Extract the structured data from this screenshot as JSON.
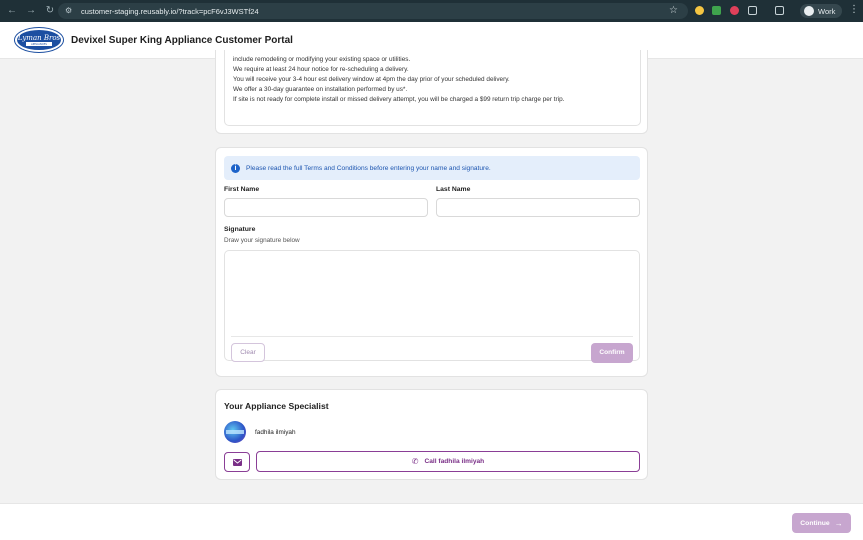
{
  "browser": {
    "url": "customer-staging.reusably.io/?track=pcF6vJ3WSTf24",
    "profile_label": "Work"
  },
  "header": {
    "logo_text": "Lyman Bros",
    "logo_subtext": "APPLIANCES",
    "title": "Devixel Super King Appliance Customer Portal"
  },
  "terms": {
    "lines": [
      "include remodeling or modifying your existing space or utilities.",
      "We require at least 24 hour notice for re-scheduling a delivery.",
      "You will receive your 3-4 hour est delivery window at 4pm the day prior of your scheduled delivery.",
      "We offer a 30-day guarantee on installation performed by us*.",
      "If site is not ready for complete install or missed delivery attempt, you will be charged a $99 return trip charge per trip."
    ]
  },
  "signature_form": {
    "banner_text": "Please read the full Terms and Conditions before entering your name and signature.",
    "first_name_label": "First Name",
    "first_name_value": "",
    "last_name_label": "Last Name",
    "last_name_value": "",
    "signature_label": "Signature",
    "signature_hint": "Draw your signature below",
    "clear_label": "Clear",
    "confirm_label": "Confirm"
  },
  "specialist": {
    "title": "Your Appliance Specialist",
    "name": "fadhila ilmiyah",
    "call_label": "Call fadhila ilmiyah"
  },
  "footer": {
    "continue_label": "Continue"
  },
  "colors": {
    "accent": "#7a2f87",
    "accent_disabled": "#c7a6cf",
    "info_bg": "#e4eefb",
    "info_text": "#1c55b0",
    "browser_bar": "#1f3037"
  },
  "icons": [
    "back-arrow-icon",
    "forward-arrow-icon",
    "reload-icon",
    "site-settings-icon",
    "bookmark-star-icon",
    "info-icon",
    "mail-icon",
    "phone-icon",
    "arrow-right-icon"
  ]
}
